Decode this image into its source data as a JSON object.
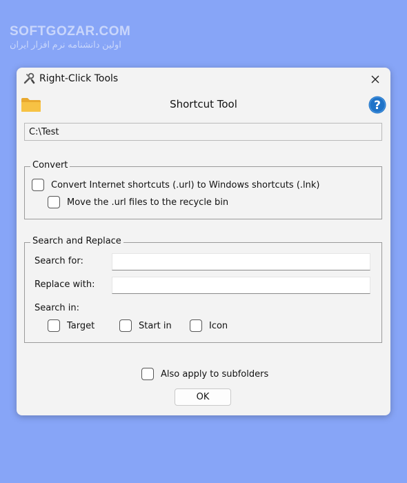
{
  "watermark": {
    "title": "SOFTGOZAR.COM",
    "subtitle": "اولین دانشنامه نرم افزار ایران"
  },
  "window": {
    "title": "Right-Click Tools",
    "heading": "Shortcut Tool",
    "path_value": "C:\\Test",
    "icons": {
      "app": "tools-icon",
      "close": "close-icon",
      "folder": "folder-icon",
      "help": "help-icon"
    }
  },
  "convert": {
    "legend": "Convert",
    "convert_label": "Convert Internet shortcuts (.url) to Windows shortcuts (.lnk)",
    "recycle_label": "Move the .url files to the recycle bin"
  },
  "search": {
    "legend": "Search and Replace",
    "search_for_label": "Search for:",
    "search_for_value": "",
    "replace_with_label": "Replace with:",
    "replace_with_value": "",
    "search_in_label": "Search in:",
    "options": [
      "Target",
      "Start in",
      "Icon"
    ]
  },
  "footer": {
    "subfolders_label": "Also apply to subfolders",
    "ok_label": "OK"
  },
  "colors": {
    "background": "#87a5f7",
    "window": "#f3f3f3",
    "help_blue": "#1f73c8",
    "folder_yellow": "#f7c244"
  }
}
